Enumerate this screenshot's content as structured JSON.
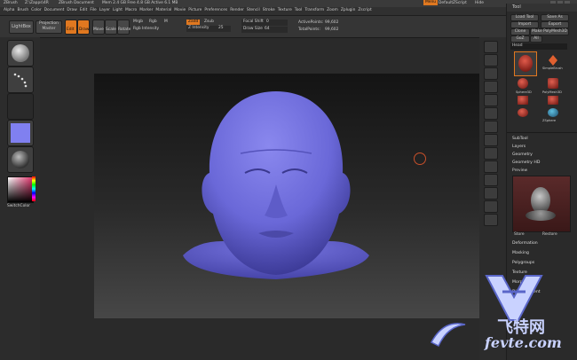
{
  "title_bar": {
    "app": "ZBrush",
    "file": "Z:\\Zapps\\4R",
    "doc": "ZBrush Document",
    "stats": "Mem 2.4 GB  Free 4.8 GB  Active 6.1 MB",
    "menu_button": "Menu",
    "default_script": "DefaultZScript",
    "hide": "Hide"
  },
  "menus": [
    "Alpha",
    "Brush",
    "Color",
    "Document",
    "Draw",
    "Edit",
    "File",
    "Layer",
    "Light",
    "Macro",
    "Marker",
    "Material",
    "Movie",
    "Picture",
    "Preferences",
    "Render",
    "Stencil",
    "Stroke",
    "Texture",
    "Tool",
    "Transform",
    "Zoom",
    "Zplugin",
    "Zscript"
  ],
  "toolbar": {
    "lightbox": "LightBox",
    "projection_master": "Projection Master",
    "buttons": [
      "Edit",
      "Draw",
      "Move",
      "Scale",
      "Rotate"
    ],
    "mrgb": "Mrgb",
    "rgb": "Rgb",
    "m": "M",
    "zadd": "Zadd",
    "zsub": "Zsub",
    "rgb_intensity": "Rgb Intensity",
    "z_intensity_label": "Z Intensity",
    "z_intensity": "25",
    "focal_shift_label": "Focal Shift",
    "focal_shift": "0",
    "draw_size_label": "Draw Size",
    "draw_size": "64",
    "active_points_label": "ActivePoints:",
    "active_points": "99,602",
    "total_points_label": "TotalPoints:",
    "total_points": "99,602"
  },
  "left_shelf": {
    "gradient_label": "Gradient",
    "color_label": "SwitchColor"
  },
  "tool_palette": {
    "title": "Tool",
    "load_tool": "Load Tool",
    "save_as": "Save As",
    "import": "Import",
    "export": "Export",
    "clone": "Clone",
    "make_polymesh": "Make PolyMesh3D",
    "goz": "GoZ",
    "all": "All",
    "current_tool": "Head",
    "thumbs": [
      "Head",
      "SimpleBrush",
      "Sphere3D",
      "PolyMesh3D",
      "Cylinder3D",
      "Cube3D",
      "Sphere",
      "ZSphere"
    ],
    "sections_top": [
      "SubTool",
      "Layers",
      "Geometry",
      "Geometry HD",
      "Preview"
    ],
    "preview_labels": [
      "Store",
      "Restore"
    ],
    "sections_bottom": [
      "Deformation",
      "Masking",
      "Polygroups",
      "Texture",
      "Morph Target",
      "Displacement"
    ]
  },
  "colors": {
    "accent": "#e07820",
    "head": "#6a68d8",
    "swatch": "#8080f0"
  },
  "watermark": {
    "line1": "飞特网",
    "line2": "fevte.com"
  }
}
